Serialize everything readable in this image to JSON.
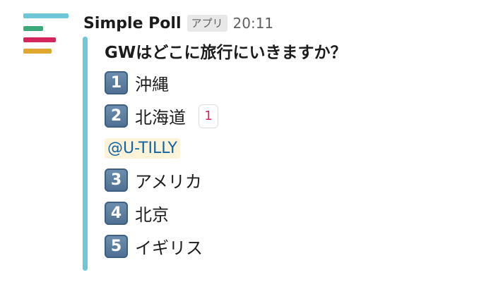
{
  "message": {
    "app_name": "Simple Poll",
    "app_badge": "アプリ",
    "time": "20:11"
  },
  "poll": {
    "question": "GWはどこに旅行にいきますか？",
    "options": [
      {
        "number": "1",
        "label": "沖縄"
      },
      {
        "number": "2",
        "label": "北海道",
        "votes": "1",
        "voters": [
          "@U-TILLY"
        ]
      },
      {
        "number": "3",
        "label": "アメリカ"
      },
      {
        "number": "4",
        "label": "北京"
      },
      {
        "number": "5",
        "label": "イギリス"
      }
    ]
  },
  "colors": {
    "attachment_bar": "#6ec6d6",
    "vote_count": "#d4265a",
    "mention": "#1264a3",
    "mention_bg": "#fdf3d9"
  },
  "icons": {
    "avatar": "simple-poll-logo-icon",
    "number_keys": "keycap-number-icon"
  }
}
